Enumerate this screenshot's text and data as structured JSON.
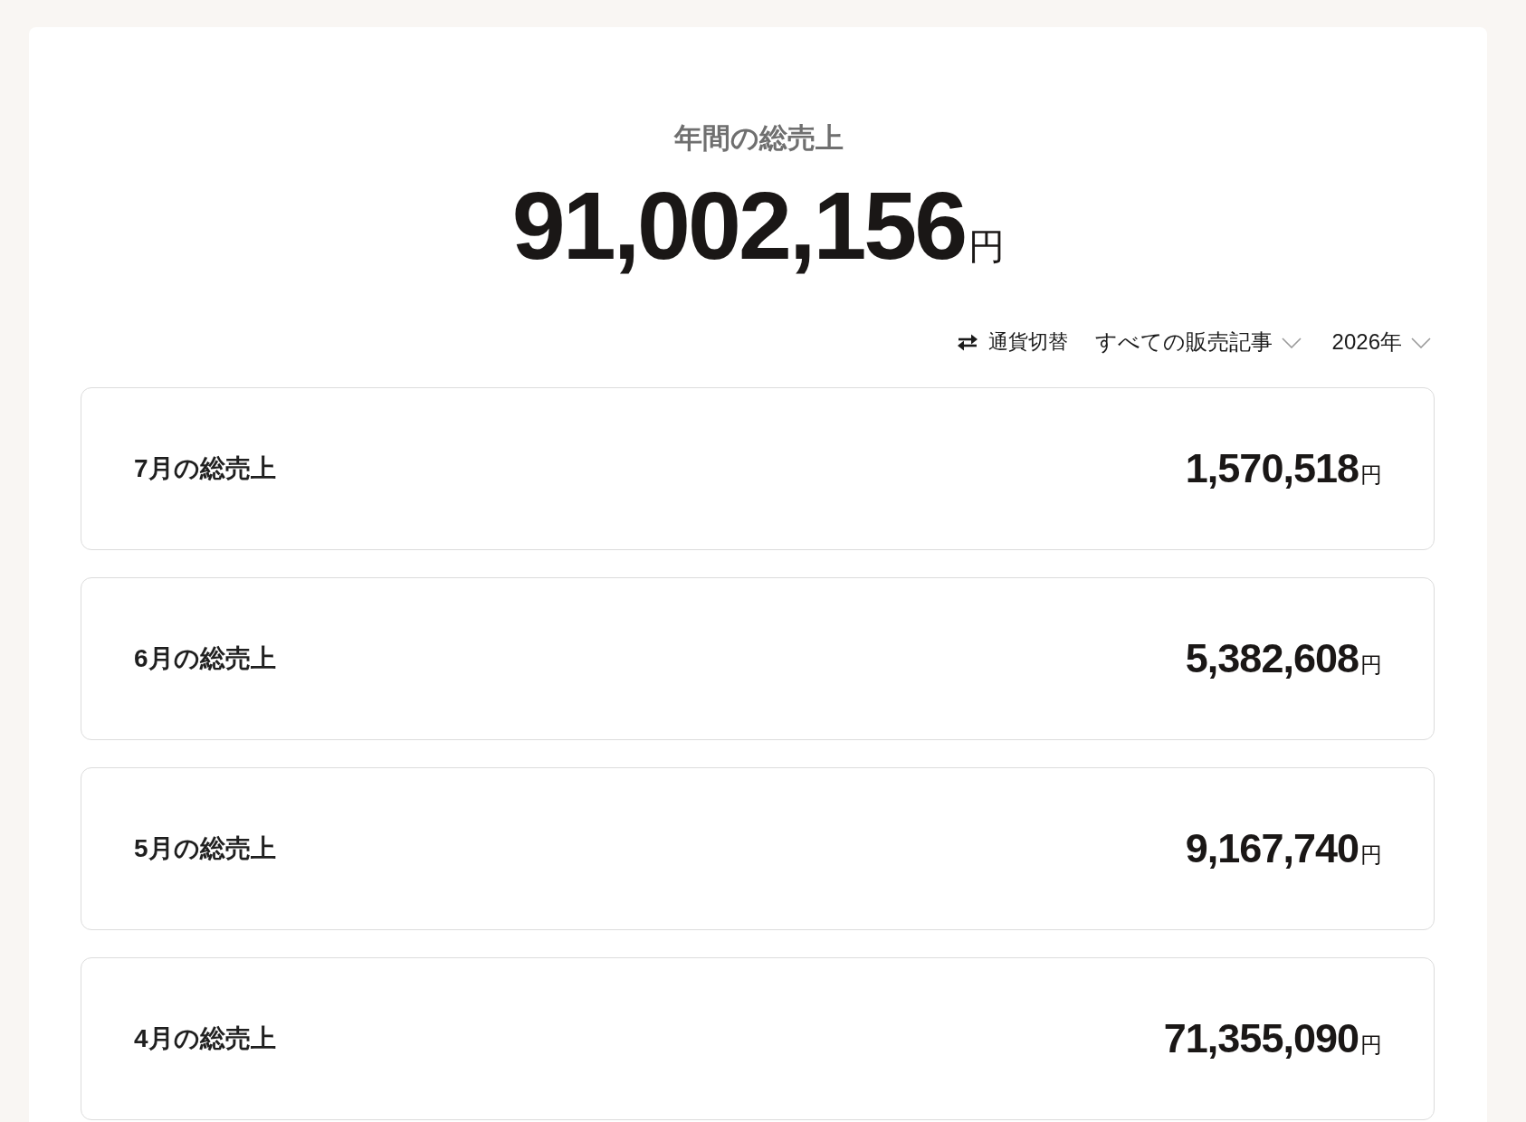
{
  "summary": {
    "title": "年間の総売上",
    "amount": "91,002,156",
    "unit": "円"
  },
  "toolbar": {
    "currency_switch": {
      "label": "通貨切替"
    },
    "article_filter": {
      "label": "すべての販売記事"
    },
    "year_filter": {
      "label": "2026年"
    }
  },
  "months": [
    {
      "label": "7月の総売上",
      "amount": "1,570,518",
      "unit": "円"
    },
    {
      "label": "6月の総売上",
      "amount": "5,382,608",
      "unit": "円"
    },
    {
      "label": "5月の総売上",
      "amount": "9,167,740",
      "unit": "円"
    },
    {
      "label": "4月の総売上",
      "amount": "71,355,090",
      "unit": "円"
    }
  ]
}
